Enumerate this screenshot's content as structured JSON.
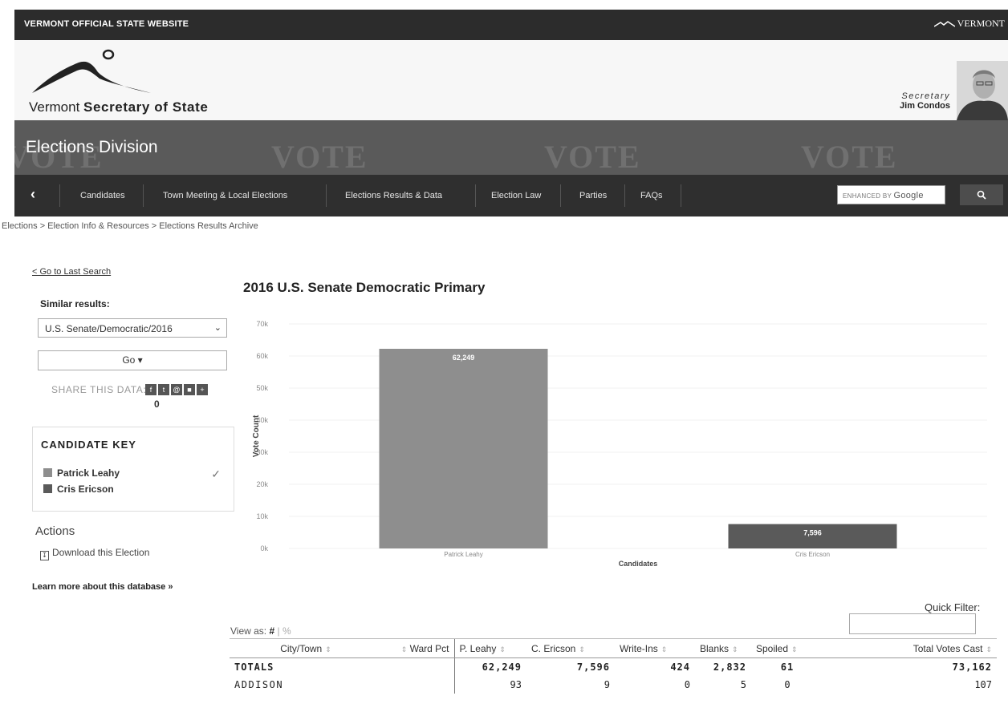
{
  "topbar": {
    "left_text": "VERMONT OFFICIAL STATE WEBSITE",
    "right_text": "VERMONT"
  },
  "header": {
    "org_prefix": "Vermont ",
    "org_name": "Secretary of State",
    "secretary_title": "Secretary",
    "secretary_name": "Jim Condos"
  },
  "banner": {
    "title": "Elections Division",
    "watermark": "VOTE"
  },
  "nav": {
    "items": [
      "Candidates",
      "Town Meeting & Local Elections",
      "Elections Results & Data",
      "Election Law",
      "Parties",
      "FAQs"
    ],
    "search_placeholder_prefix": "ENHANCED BY ",
    "search_placeholder_brand": "Google",
    "search_button_icon": "search-icon"
  },
  "breadcrumb": "Elections > Election Info & Resources > Elections Results Archive",
  "sidebar": {
    "last_search": "< Go to Last Search",
    "similar_label": "Similar results:",
    "similar_selected": "U.S. Senate/Democratic/2016",
    "go_label": "Go ▾",
    "share_label": "SHARE THIS DATA:",
    "share_count": "0",
    "candidate_key_title": "CANDIDATE KEY",
    "candidates": [
      {
        "name": "Patrick Leahy",
        "color": "#8e8e8e"
      },
      {
        "name": "Cris Ericson",
        "color": "#5a5a5a"
      }
    ],
    "actions_title": "Actions",
    "download_label": "Download this Election",
    "learn_more": "Learn more about this database »"
  },
  "chart_title": "2016 U.S. Senate Democratic Primary",
  "chart_data": {
    "type": "bar",
    "title": "2016 U.S. Senate Democratic Primary",
    "categories": [
      "Patrick Leahy",
      "Cris Ericson"
    ],
    "values": [
      62249,
      7596
    ],
    "data_labels": [
      "62,249",
      "7,596"
    ],
    "colors": [
      "#8e8e8e",
      "#5a5a5a"
    ],
    "xlabel": "Candidates",
    "ylabel": "Vote Count",
    "ylim": [
      0,
      70000
    ],
    "yticks": [
      "0k",
      "10k",
      "20k",
      "30k",
      "40k",
      "50k",
      "60k",
      "70k"
    ]
  },
  "table": {
    "quick_filter_label": "Quick Filter:",
    "view_as_label": "View as:",
    "view_as_num": "#",
    "view_as_sep": "|",
    "view_as_pct": "%",
    "columns": [
      "City/Town",
      "Ward",
      "Pct",
      "P. Leahy",
      "C. Ericson",
      "Write-Ins",
      "Blanks",
      "Spoiled",
      "Total Votes Cast"
    ],
    "rows": [
      [
        "TOTALS",
        "",
        "",
        "62,249",
        "7,596",
        "424",
        "2,832",
        "61",
        "73,162"
      ],
      [
        "ADDISON",
        "",
        "",
        "93",
        "9",
        "0",
        "5",
        "0",
        "107"
      ]
    ]
  }
}
